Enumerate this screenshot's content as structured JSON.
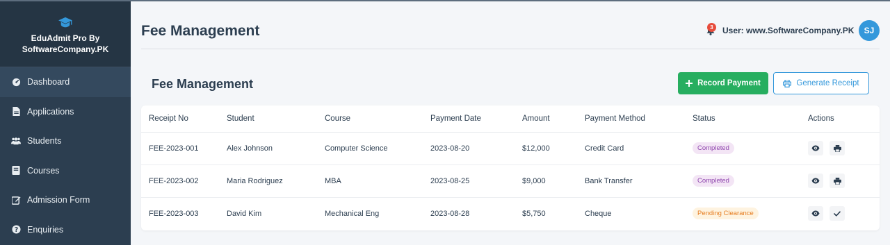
{
  "brand": {
    "line1": "EduAdmit Pro By",
    "line2": "SoftwareCompany.PK",
    "icon": "graduation-cap-icon"
  },
  "sidebar": {
    "items": [
      {
        "label": "Dashboard",
        "icon": "dashboard-icon",
        "active": true
      },
      {
        "label": "Applications",
        "icon": "file-icon",
        "active": false
      },
      {
        "label": "Students",
        "icon": "users-icon",
        "active": false
      },
      {
        "label": "Courses",
        "icon": "book-icon",
        "active": false
      },
      {
        "label": "Admission Form",
        "icon": "edit-icon",
        "active": false
      },
      {
        "label": "Enquiries",
        "icon": "question-circle-icon",
        "active": false
      }
    ]
  },
  "header": {
    "title": "Fee Management",
    "notification_count": "3",
    "user_label": "User: www.SoftwareCompany.PK",
    "avatar_initials": "SJ"
  },
  "section": {
    "title": "Fee Management",
    "record_payment_label": "Record Payment",
    "generate_receipt_label": "Generate Receipt"
  },
  "table": {
    "columns": [
      "Receipt No",
      "Student",
      "Course",
      "Payment Date",
      "Amount",
      "Payment Method",
      "Status",
      "Actions"
    ],
    "rows": [
      {
        "receipt": "FEE-2023-001",
        "student": "Alex Johnson",
        "course": "Computer Science",
        "date": "2023-08-20",
        "amount": "$12,000",
        "method": "Credit Card",
        "status": "Completed",
        "status_type": "completed",
        "actions": [
          "view",
          "print"
        ]
      },
      {
        "receipt": "FEE-2023-002",
        "student": "Maria Rodriguez",
        "course": "MBA",
        "date": "2023-08-25",
        "amount": "$9,000",
        "method": "Bank Transfer",
        "status": "Completed",
        "status_type": "completed",
        "actions": [
          "view",
          "print"
        ]
      },
      {
        "receipt": "FEE-2023-003",
        "student": "David Kim",
        "course": "Mechanical Eng",
        "date": "2023-08-28",
        "amount": "$5,750",
        "method": "Cheque",
        "status": "Pending Clearance",
        "status_type": "pending",
        "actions": [
          "view",
          "check"
        ]
      }
    ]
  },
  "colors": {
    "sidebar": "#2c3e50",
    "primary": "#3498db",
    "success": "#27ae60",
    "danger": "#e74c3c"
  }
}
